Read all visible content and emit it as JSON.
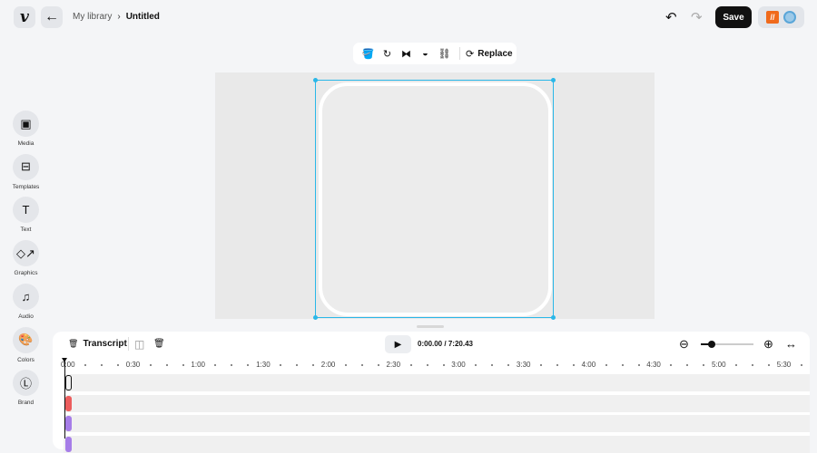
{
  "header": {
    "breadcrumb_parent": "My library",
    "breadcrumb_sep": "›",
    "title": "Untitled",
    "save_label": "Save",
    "logo": "v",
    "back_icon": "←",
    "undo_icon": "↶",
    "redo_icon": "↷",
    "account_badge": "//"
  },
  "toolbar": {
    "icons": [
      "🪣",
      "↻",
      "⧓",
      "◒",
      "⛓"
    ],
    "replace_icon": "⟳",
    "replace_label": "Replace"
  },
  "sidebar": {
    "items": [
      {
        "label": "Media",
        "icon": "▣"
      },
      {
        "label": "Templates",
        "icon": "⊟"
      },
      {
        "label": "Text",
        "icon": "T"
      },
      {
        "label": "Graphics",
        "icon": "◇↗"
      },
      {
        "label": "Audio",
        "icon": "♫"
      },
      {
        "label": "Colors",
        "icon": "🎨"
      },
      {
        "label": "Brand",
        "icon": "Ⓛ"
      }
    ]
  },
  "timeline": {
    "transcript_label": "Transcript",
    "split_icon": "◫",
    "delete_icon": "🗑",
    "play_icon": "▶",
    "current_time": "0:00.00",
    "separator": "/",
    "duration": "7:20.43",
    "zoom_out_icon": "⊖",
    "zoom_in_icon": "⊕",
    "fit_icon": "↔",
    "zoom_level": 0.2,
    "ruler_labels": [
      "0:00",
      "0:30",
      "1:00",
      "1:30",
      "2:00",
      "2:30",
      "3:00",
      "3:30",
      "4:00",
      "4:30",
      "5:00",
      "5:30"
    ],
    "tracks": [
      {
        "color": "#f1f1f1",
        "selected": true
      },
      {
        "color": "#ec5d5d"
      },
      {
        "color": "#a67de8"
      },
      {
        "color": "#a67de8"
      }
    ]
  }
}
